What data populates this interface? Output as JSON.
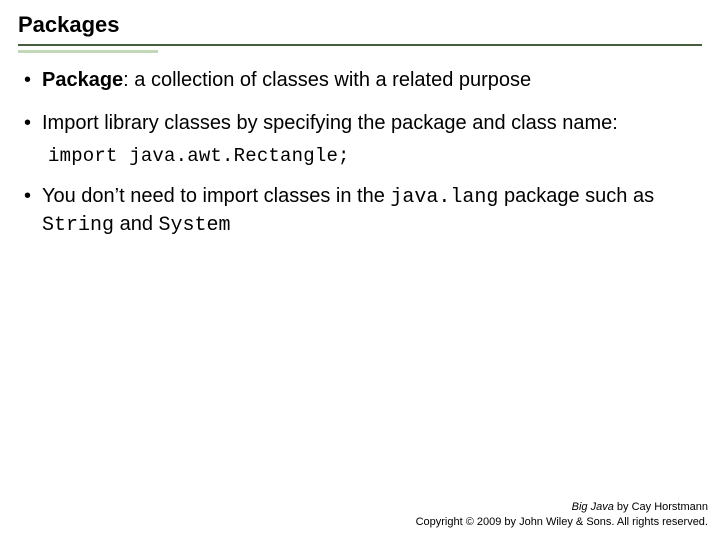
{
  "title": "Packages",
  "bullets": [
    {
      "term": "Package",
      "after": ": a collection of classes with a related purpose"
    },
    {
      "text": "Import library classes by specifying the package and class name:"
    },
    {
      "p1": "You don’t need to import classes in the ",
      "c1": "java.lang",
      "p2": " package such as ",
      "c2": "String",
      "p3": " and ",
      "c3": "System"
    }
  ],
  "code_line": "import java.awt.Rectangle;",
  "footer": {
    "book": "Big Java",
    "by": " by Cay Horstmann",
    "copyright": "Copyright © 2009 by John Wiley & Sons. All rights reserved."
  }
}
